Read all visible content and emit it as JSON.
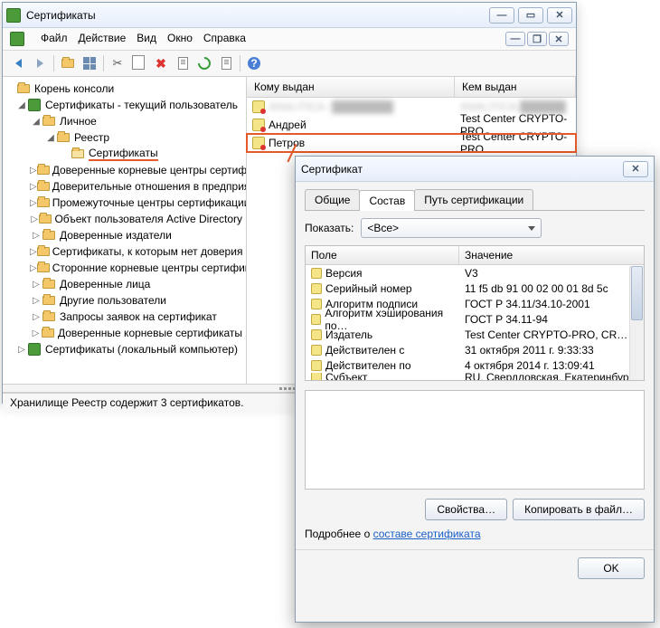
{
  "main": {
    "title": "Сертификаты",
    "menu": {
      "file": "Файл",
      "action": "Действие",
      "view": "Вид",
      "window": "Окно",
      "help": "Справка"
    },
    "tree": {
      "root": "Корень консоли",
      "n1": "Сертификаты - текущий пользователь",
      "n2": "Личное",
      "n3": "Реестр",
      "n4": "Сертификаты",
      "n5": "Доверенные корневые центры сертификации",
      "n6": "Доверительные отношения в предприятии",
      "n7": "Промежуточные центры сертификации",
      "n8": "Объект пользователя Active Directory",
      "n9": "Доверенные издатели",
      "n10": "Сертификаты, к которым нет доверия",
      "n11": "Сторонние корневые центры сертификации",
      "n12": "Доверенные лица",
      "n13": "Другие пользователи",
      "n14": "Запросы заявок на сертификат",
      "n15": "Доверенные корневые сертификаты",
      "n16": "Сертификаты (локальный компьютер)"
    },
    "list": {
      "col1": "Кому выдан",
      "col2": "Кем выдан",
      "rows": [
        {
          "subject": "ANALITICA-",
          "issuer": "ANALITICA-",
          "blur": true
        },
        {
          "subject": "Андрей",
          "issuer": "Test Center CRYPTO-PRO",
          "blur": false
        },
        {
          "subject": "Петров",
          "issuer": "Test Center CRYPTO-PRO",
          "blur": false,
          "highlight": true
        }
      ]
    },
    "status": "Хранилище Реестр содержит 3 сертификатов."
  },
  "dialog": {
    "title": "Сертификат",
    "tabs": {
      "general": "Общие",
      "details": "Состав",
      "path": "Путь сертификации"
    },
    "show_label": "Показать:",
    "show_value": "<Все>",
    "col_field": "Поле",
    "col_value": "Значение",
    "fields": [
      {
        "f": "Версия",
        "v": "V3"
      },
      {
        "f": "Серийный номер",
        "v": "11 f5 db 91 00 02 00 01 8d 5c"
      },
      {
        "f": "Алгоритм подписи",
        "v": "ГОСТ Р 34.11/34.10-2001"
      },
      {
        "f": "Алгоритм хэширования по…",
        "v": "ГОСТ Р 34.11-94"
      },
      {
        "f": "Издатель",
        "v": "Test Center CRYPTO-PRO, CR…"
      },
      {
        "f": "Действителен с",
        "v": "31 октября 2011 г. 9:33:33"
      },
      {
        "f": "Действителен по",
        "v": "4 октября 2014 г. 13:09:41"
      },
      {
        "f": "Субъект",
        "v": "RU, Свердловская, Екатеринбург"
      }
    ],
    "btn_props": "Свойства…",
    "btn_copy": "Копировать в файл…",
    "link_prefix": "Подробнее о ",
    "link_text": "составе сертификата",
    "btn_ok": "OK"
  }
}
